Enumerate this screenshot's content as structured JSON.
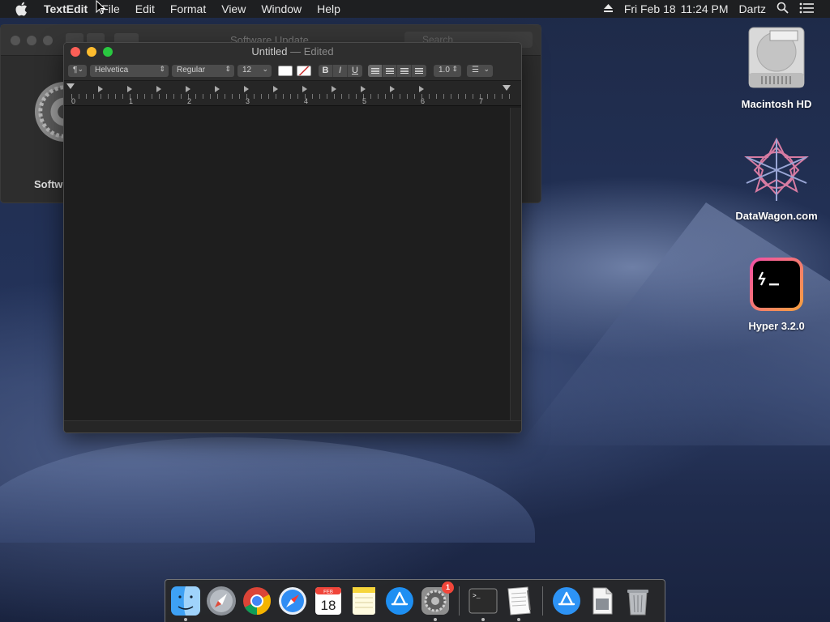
{
  "menubar": {
    "app_name": "TextEdit",
    "items": [
      "File",
      "Edit",
      "Format",
      "View",
      "Window",
      "Help"
    ],
    "date": "Fri Feb 18",
    "time": "11:24 PM",
    "user": "Dartz"
  },
  "software_update": {
    "title": "Software Update",
    "search_placeholder": "Search",
    "label": "Softw"
  },
  "textedit": {
    "title": "Untitled",
    "title_suffix": "— Edited",
    "paragraph_style": "¶",
    "font_family": "Helvetica",
    "font_style": "Regular",
    "font_size": "12",
    "bold": "B",
    "italic": "I",
    "underline": "U",
    "line_spacing": "1.0",
    "ruler_numbers": [
      "0",
      "1",
      "2",
      "3",
      "4",
      "5",
      "6",
      "7"
    ]
  },
  "desktop_icons": [
    {
      "label": "Macintosh HD",
      "icon": "hard-drive-icon"
    },
    {
      "label": "DataWagon.com",
      "icon": "datawagon-icon"
    },
    {
      "label": "Hyper 3.2.0",
      "icon": "hyper-terminal-icon"
    }
  ],
  "dock": {
    "apps": [
      "finder-icon",
      "launchpad-icon",
      "chrome-icon",
      "safari-icon",
      "calendar-icon",
      "notes-icon",
      "app-store-icon",
      "system-preferences-icon",
      "terminal-icon",
      "textedit-icon",
      "app-store-downloads-icon",
      "preview-icon",
      "trash-icon"
    ],
    "calendar_month": "FEB",
    "calendar_day": "18",
    "prefs_badge": "1",
    "terminal_prompt": ">_"
  }
}
